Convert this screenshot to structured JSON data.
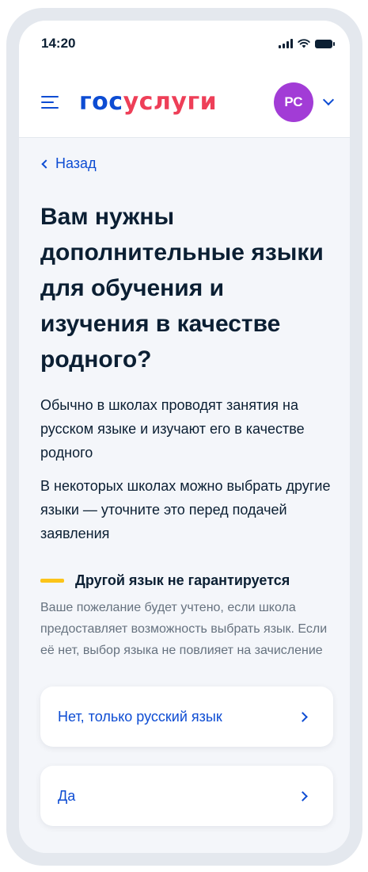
{
  "status_bar": {
    "time": "14:20"
  },
  "header": {
    "logo_part1": "гос",
    "logo_part2": "услуги",
    "avatar_initials": "РС"
  },
  "nav": {
    "back_label": "Назад"
  },
  "main": {
    "title": "Вам нужны дополнительные языки для обучения и изучения в качестве родного?",
    "paragraphs": [
      "Обычно в школах проводят занятия на русском языке и изучают его в качестве родного",
      "В некоторых школах можно выбрать другие языки — уточните это перед подачей заявления"
    ],
    "notice": {
      "title": "Другой язык не гарантируется",
      "text": "Ваше пожелание будет учтено, если школа предоставляет возможность выбрать язык. Если её нет, выбор языка не повлияет на зачисление"
    },
    "options": [
      {
        "label": "Нет, только русский язык"
      },
      {
        "label": "Да"
      }
    ]
  },
  "colors": {
    "brand_blue": "#0d4cd3",
    "brand_red": "#ee3f58",
    "avatar": "#a23cd6",
    "notice_accent": "#fcc419"
  }
}
